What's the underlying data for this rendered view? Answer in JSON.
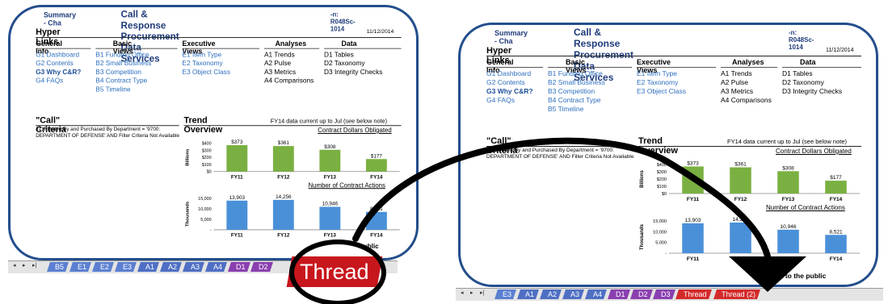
{
  "dashboard": {
    "header_left": "Summary - Cha",
    "title": "Call & Response Procurement Data Services",
    "header_right": "-n: R048Sc-1014",
    "hyper_links_title": "Hyper Links",
    "date": "11/12/2014",
    "columns": [
      {
        "head": "General Info",
        "items": [
          {
            "label": "G1 Dashboard",
            "bold": false
          },
          {
            "label": "G2 Contents",
            "bold": false
          },
          {
            "label": "G3 Why C&R?",
            "bold": true
          },
          {
            "label": "G4 FAQs",
            "bold": false
          }
        ]
      },
      {
        "head": "Basic Views",
        "items": [
          {
            "label": "B1 Funding Office",
            "bold": false
          },
          {
            "label": "B2 Small Business",
            "bold": false
          },
          {
            "label": "B3 Competition",
            "bold": false
          },
          {
            "label": "B4 Contract Type",
            "bold": false
          },
          {
            "label": "B5 Timeline",
            "bold": false
          }
        ]
      },
      {
        "head": "Executive Views",
        "items": [
          {
            "label": "E1 Item Type",
            "bold": false
          },
          {
            "label": "E2 Taxonomy",
            "bold": false
          },
          {
            "label": "E3 Object Class",
            "bold": false
          }
        ]
      },
      {
        "head": "Analyses",
        "items": [
          {
            "label": "A1 Trends",
            "bold": false
          },
          {
            "label": "A2 Pulse",
            "bold": false
          },
          {
            "label": "A3 Metrics",
            "bold": false
          },
          {
            "label": "A4 Comparisons",
            "bold": false
          }
        ]
      },
      {
        "head": "Data",
        "items": [
          {
            "label": "D1 Tables",
            "bold": false
          },
          {
            "label": "D2 Taxonomy",
            "bold": false
          },
          {
            "label": "D3 Integrity Checks",
            "bold": false
          }
        ]
      }
    ],
    "call_criteria_title": "\"Call\" Criteria",
    "call_criteria_text": "#1: Funded By and Purchased By Department = '9700: DEPARTMENT OF DEFENSE' AND Filter Criteria Not Available",
    "trend_title": "Trend Overview",
    "trend_note": "FY14 data current up to Jul (see below note)",
    "public_note_1": "ublic",
    "public_note_2": "data to the public"
  },
  "chart_data": [
    {
      "type": "bar",
      "title": "Contract Dollars Obligated",
      "ylabel": "Billions",
      "categories": [
        "FY11",
        "FY12",
        "FY13",
        "FY14"
      ],
      "values": [
        373,
        361,
        308,
        177
      ],
      "data_labels": [
        "$373",
        "$361",
        "$308",
        "$177"
      ],
      "yticks": [
        "$400",
        "$300",
        "$200",
        "$100",
        "$0"
      ],
      "ylim": [
        0,
        400
      ],
      "color": "#7ab041"
    },
    {
      "type": "bar",
      "title": "Number of Contract Actions",
      "ylabel": "Thousands",
      "categories": [
        "FY11",
        "FY12",
        "FY13",
        "FY14"
      ],
      "values": [
        13903,
        14256,
        10946,
        8521
      ],
      "data_labels": [
        "13,903",
        "14,256",
        "10,946",
        "8,521"
      ],
      "yticks": [
        "15,000",
        "10,000",
        "5,000",
        "-"
      ],
      "ylim": [
        0,
        15000
      ],
      "color": "#4a90d9"
    }
  ],
  "tabs_left": {
    "items": [
      {
        "label": "B5",
        "color": "#5b7fd1"
      },
      {
        "label": "E1",
        "color": "#5b7fd1"
      },
      {
        "label": "E2",
        "color": "#5b7fd1"
      },
      {
        "label": "E3",
        "color": "#5b7fd1"
      },
      {
        "label": "A1",
        "color": "#4f6fc4"
      },
      {
        "label": "A2",
        "color": "#4f6fc4"
      },
      {
        "label": "A3",
        "color": "#4f6fc4"
      },
      {
        "label": "A4",
        "color": "#4f6fc4"
      },
      {
        "label": "D1",
        "color": "#8a3fb0"
      },
      {
        "label": "D2",
        "color": "#8a3fb0"
      }
    ],
    "big_tab": "Thread"
  },
  "tabs_right": {
    "items": [
      {
        "label": "E3",
        "color": "#5b7fd1"
      },
      {
        "label": "A1",
        "color": "#4f6fc4"
      },
      {
        "label": "A2",
        "color": "#4f6fc4"
      },
      {
        "label": "A3",
        "color": "#4f6fc4"
      },
      {
        "label": "A4",
        "color": "#4f6fc4"
      },
      {
        "label": "D1",
        "color": "#8a3fb0"
      },
      {
        "label": "D2",
        "color": "#8a3fb0"
      },
      {
        "label": "D3",
        "color": "#8a3fb0"
      },
      {
        "label": "Thread",
        "color": "#d42a2a"
      },
      {
        "label": "Thread (2)",
        "color": "#d42a2a"
      }
    ]
  },
  "nav_glyphs": [
    "◂",
    "▸",
    "▸|"
  ],
  "overlay": {
    "arrow_color": "#000000",
    "circle_color": "#000000"
  }
}
